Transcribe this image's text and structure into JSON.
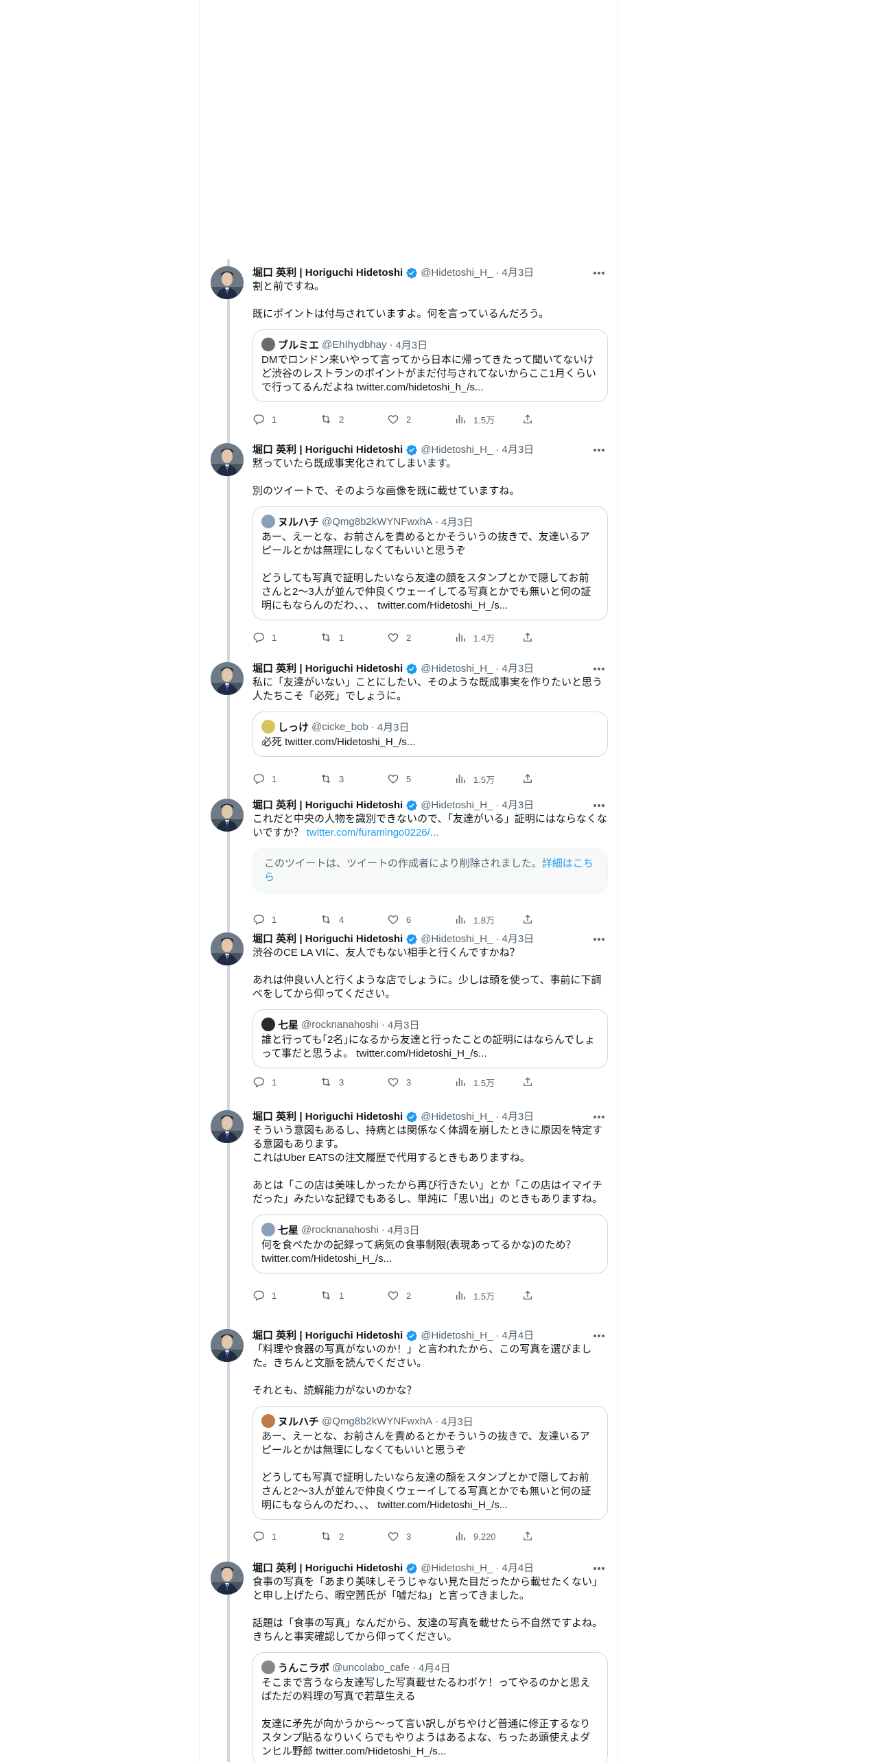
{
  "author": {
    "name": "堀口 英利 | Horiguchi Hidetoshi",
    "handle": "@Hidetoshi_H_"
  },
  "colors": {
    "verified": "#1d9bf0",
    "link": "#1d9bf0",
    "muted": "#536471",
    "thread_line": "#cfd9de"
  },
  "icons": [
    "verified-badge-icon",
    "more-icon",
    "reply-icon",
    "retweet-icon",
    "like-icon",
    "views-icon",
    "share-icon"
  ],
  "tweets": [
    {
      "date": "4月3日",
      "text": "割と前ですね。\n\n既にポイントは付与されていますよ。何を言っているんだろう。",
      "quote": {
        "name": "ブルミエ",
        "handle": "@EhIhydbhay",
        "date": "4月3日",
        "text": "DMでロンドン来いやって言ってから日本に帰ってきたって聞いてないけど渋谷のレストランのポイントがまだ付与されてないからここ1月くらいで行ってるんだよね twitter.com/hidetoshi_h_/s..."
      },
      "stats": {
        "replies": "1",
        "retweets": "2",
        "likes": "2",
        "views": "1.5万"
      }
    },
    {
      "date": "4月3日",
      "text": "黙っていたら既成事実化されてしまいます。\n\n別のツイートで、そのような画像を既に載せていますね。",
      "quote": {
        "name": "ヌルハチ",
        "handle": "@Qmg8b2kWYNFwxhA",
        "date": "4月3日",
        "text": "あー、えーとな、お前さんを責めるとかそういうの抜きで、友達いるアピールとかは無理にしなくてもいいと思うぞ\n\nどうしても写真で証明したいなら友達の顔をスタンプとかで隠してお前さんと2〜3人が並んで仲良くウェーイしてる写真とかでも無いと何の証明にもならんのだわ、、、 twitter.com/Hidetoshi_H_/s..."
      },
      "stats": {
        "replies": "1",
        "retweets": "1",
        "likes": "2",
        "views": "1.4万"
      }
    },
    {
      "date": "4月3日",
      "text": "私に「友達がいない」ことにしたい、そのような既成事実を作りたいと思う人たちこそ「必死」でしょうに。",
      "quote": {
        "name": "しっけ",
        "handle": "@cicke_bob",
        "date": "4月3日",
        "text": "必死 twitter.com/Hidetoshi_H_/s..."
      },
      "stats": {
        "replies": "1",
        "retweets": "3",
        "likes": "5",
        "views": "1.5万"
      }
    },
    {
      "date": "4月3日",
      "text": "これだと中央の人物を識別できないので、「友達がいる」証明にはならなくないですか？ ",
      "link": "twitter.com/furamingo0226/...",
      "deleted": {
        "text": "このツイートは、ツイートの作成者により削除されました。",
        "link": "詳細はこちら"
      },
      "stats": {
        "replies": "1",
        "retweets": "4",
        "likes": "6",
        "views": "1.8万"
      }
    },
    {
      "date": "4月3日",
      "text": "渋谷のCE LA VIに、友人でもない相手と行くんですかね？\n\nあれは仲良い人と行くような店でしょうに。少しは頭を使って、事前に下調べをしてから仰ってください。",
      "quote": {
        "name": "七星",
        "handle": "@rocknanahoshi",
        "date": "4月3日",
        "text": "誰と行っても｢2名｣になるから友達と行ったことの証明にはならんでしょって事だと思うよ。 twitter.com/Hidetoshi_H_/s..."
      },
      "stats": {
        "replies": "1",
        "retweets": "3",
        "likes": "3",
        "views": "1.5万"
      }
    },
    {
      "date": "4月3日",
      "text": "そういう意図もあるし、持病とは関係なく体調を崩したときに原因を特定する意図もあります。\nこれはUber EATSの注文履歴で代用するときもありますね。\n\nあとは「この店は美味しかったから再び行きたい」とか「この店はイマイチだった」みたいな記録でもあるし、単純に「思い出」のときもありますね。",
      "quote": {
        "name": "七星",
        "handle": "@rocknanahoshi",
        "date": "4月3日",
        "text": "何を食べたかの記録って病気の食事制限(表現あってるかな)のため？ twitter.com/Hidetoshi_H_/s..."
      },
      "stats": {
        "replies": "1",
        "retweets": "1",
        "likes": "2",
        "views": "1.5万"
      }
    },
    {
      "date": "4月4日",
      "text": "「料理や食器の写真がないのか！」と言われたから、この写真を選びました。きちんと文脈を読んでください。\n\nそれとも、読解能力がないのかな？",
      "quote": {
        "name": "ヌルハチ",
        "handle": "@Qmg8b2kWYNFwxhA",
        "date": "4月3日",
        "text": "あー、えーとな、お前さんを責めるとかそういうの抜きで、友達いるアピールとかは無理にしなくてもいいと思うぞ\n\nどうしても写真で証明したいなら友達の顔をスタンプとかで隠してお前さんと2〜3人が並んで仲良くウェーイしてる写真とかでも無いと何の証明にもならんのだわ、、、 twitter.com/Hidetoshi_H_/s..."
      },
      "stats": {
        "replies": "1",
        "retweets": "2",
        "likes": "3",
        "views": "9,220"
      }
    },
    {
      "date": "4月4日",
      "text": "食事の写真を「あまり美味しそうじゃない見た目だったから載せたくない」と申し上げたら、暇空茜氏が「嘘だね」と言ってきました。\n\n話題は「食事の写真」なんだから、友達の写真を載せたら不自然ですよね。きちんと事実確認してから仰ってください。",
      "quote": {
        "name": "うんこラボ",
        "handle": "@uncolabo_cafe",
        "date": "4月4日",
        "text": "そこまで言うなら友達写した写真載せたるわボケ！ってやるのかと思えばただの料理の写真で若草生える\n\n友達に矛先が向かうから〜って言い訳しがちやけど普通に修正するなりスタンプ貼るなりいくらでもやりようはあるよな、ちったあ頭使えよダンヒル野郎 twitter.com/Hidetoshi_H_/s..."
      }
    }
  ]
}
